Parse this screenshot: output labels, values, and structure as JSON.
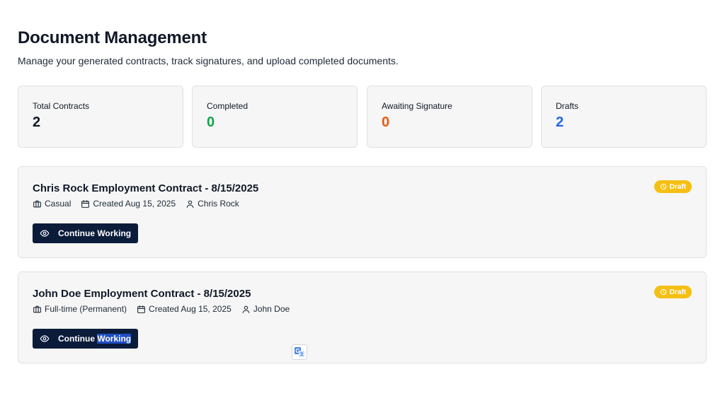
{
  "header": {
    "title": "Document Management",
    "subtitle": "Manage your generated contracts, track signatures, and upload completed documents."
  },
  "stats": [
    {
      "label": "Total Contracts",
      "value": "2",
      "color": "#111827"
    },
    {
      "label": "Completed",
      "value": "0",
      "color": "#16a34a"
    },
    {
      "label": "Awaiting Signature",
      "value": "0",
      "color": "#ea580c"
    },
    {
      "label": "Drafts",
      "value": "2",
      "color": "#2563eb"
    }
  ],
  "contracts": [
    {
      "title": "Chris Rock Employment Contract - 8/15/2025",
      "type": "Casual",
      "created": "Created Aug 15, 2025",
      "person": "Chris Rock",
      "status": "Draft",
      "action_label": "Continue Working"
    },
    {
      "title": "John Doe Employment Contract - 8/15/2025",
      "type": "Full-time (Permanent)",
      "created": "Created Aug 15, 2025",
      "person": "John Doe",
      "status": "Draft",
      "action_label_first": "Continue",
      "action_label_second": "Working"
    }
  ],
  "colors": {
    "button_bg": "#0b1b3a",
    "badge_bg": "#f5bf13",
    "card_bg": "#f5f6f5",
    "selection_highlight": "#1f4fc2"
  },
  "icons": {
    "button": "eye-icon",
    "badge": "clock-icon",
    "meta_type": "briefcase-icon",
    "meta_created": "calendar-icon",
    "meta_person": "user-icon",
    "widget": "translate-icon"
  }
}
